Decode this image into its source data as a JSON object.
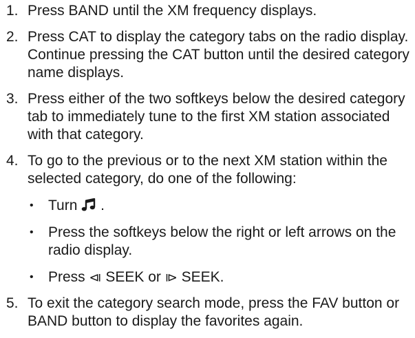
{
  "steps": [
    {
      "number": "1.",
      "text": "Press BAND until the XM frequency displays."
    },
    {
      "number": "2.",
      "text": "Press CAT to display the category tabs on the radio display. Continue pressing the CAT button until the desired category name displays."
    },
    {
      "number": "3.",
      "text": "Press either of the two softkeys below the desired category tab to immediately tune to the first XM station associated with that category."
    },
    {
      "number": "4.",
      "text": "To go to the previous or to the next XM station within the selected category, do one of the following:",
      "bullets": {
        "marker": "•",
        "turn_prefix": "Turn",
        "turn_icon": "music-note-knob-icon",
        "turn_suffix": ".",
        "softkeys": "Press the softkeys below the right or left arrows on the radio display.",
        "press_prefix": "Press",
        "seek_back_glyph": "⧏",
        "seek_back_label": "SEEK or",
        "seek_fwd_glyph": "⧐",
        "seek_fwd_label": "SEEK."
      }
    },
    {
      "number": "5.",
      "text": "To exit the category search mode, press the FAV button or BAND button to display the favorites again."
    }
  ]
}
